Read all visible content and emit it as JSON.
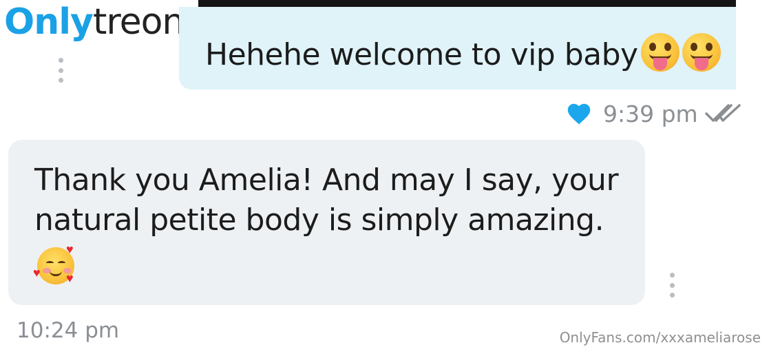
{
  "logo": {
    "part1": "Only",
    "part2": "treon"
  },
  "messages": {
    "outgoing": {
      "text": "Hehehe welcome to vip baby",
      "emojis": [
        "face-with-tongue-icon",
        "face-with-tongue-icon"
      ],
      "time": "9:39 pm",
      "liked": true,
      "status": "read"
    },
    "incoming": {
      "text": "Thank you Amelia! And may I say, your\nnatural petite body is simply amazing.",
      "emoji": "smiling-face-with-hearts-icon",
      "time": "10:24 pm"
    }
  },
  "watermark_url": "OnlyFans.com/xxxameliarose",
  "colors": {
    "brand_blue": "#1aa1e6",
    "outgoing_bubble": "#dff3f9",
    "incoming_bubble": "#eef1f3",
    "meta_text": "#8a8f94",
    "heart": "#1ca7ec"
  }
}
